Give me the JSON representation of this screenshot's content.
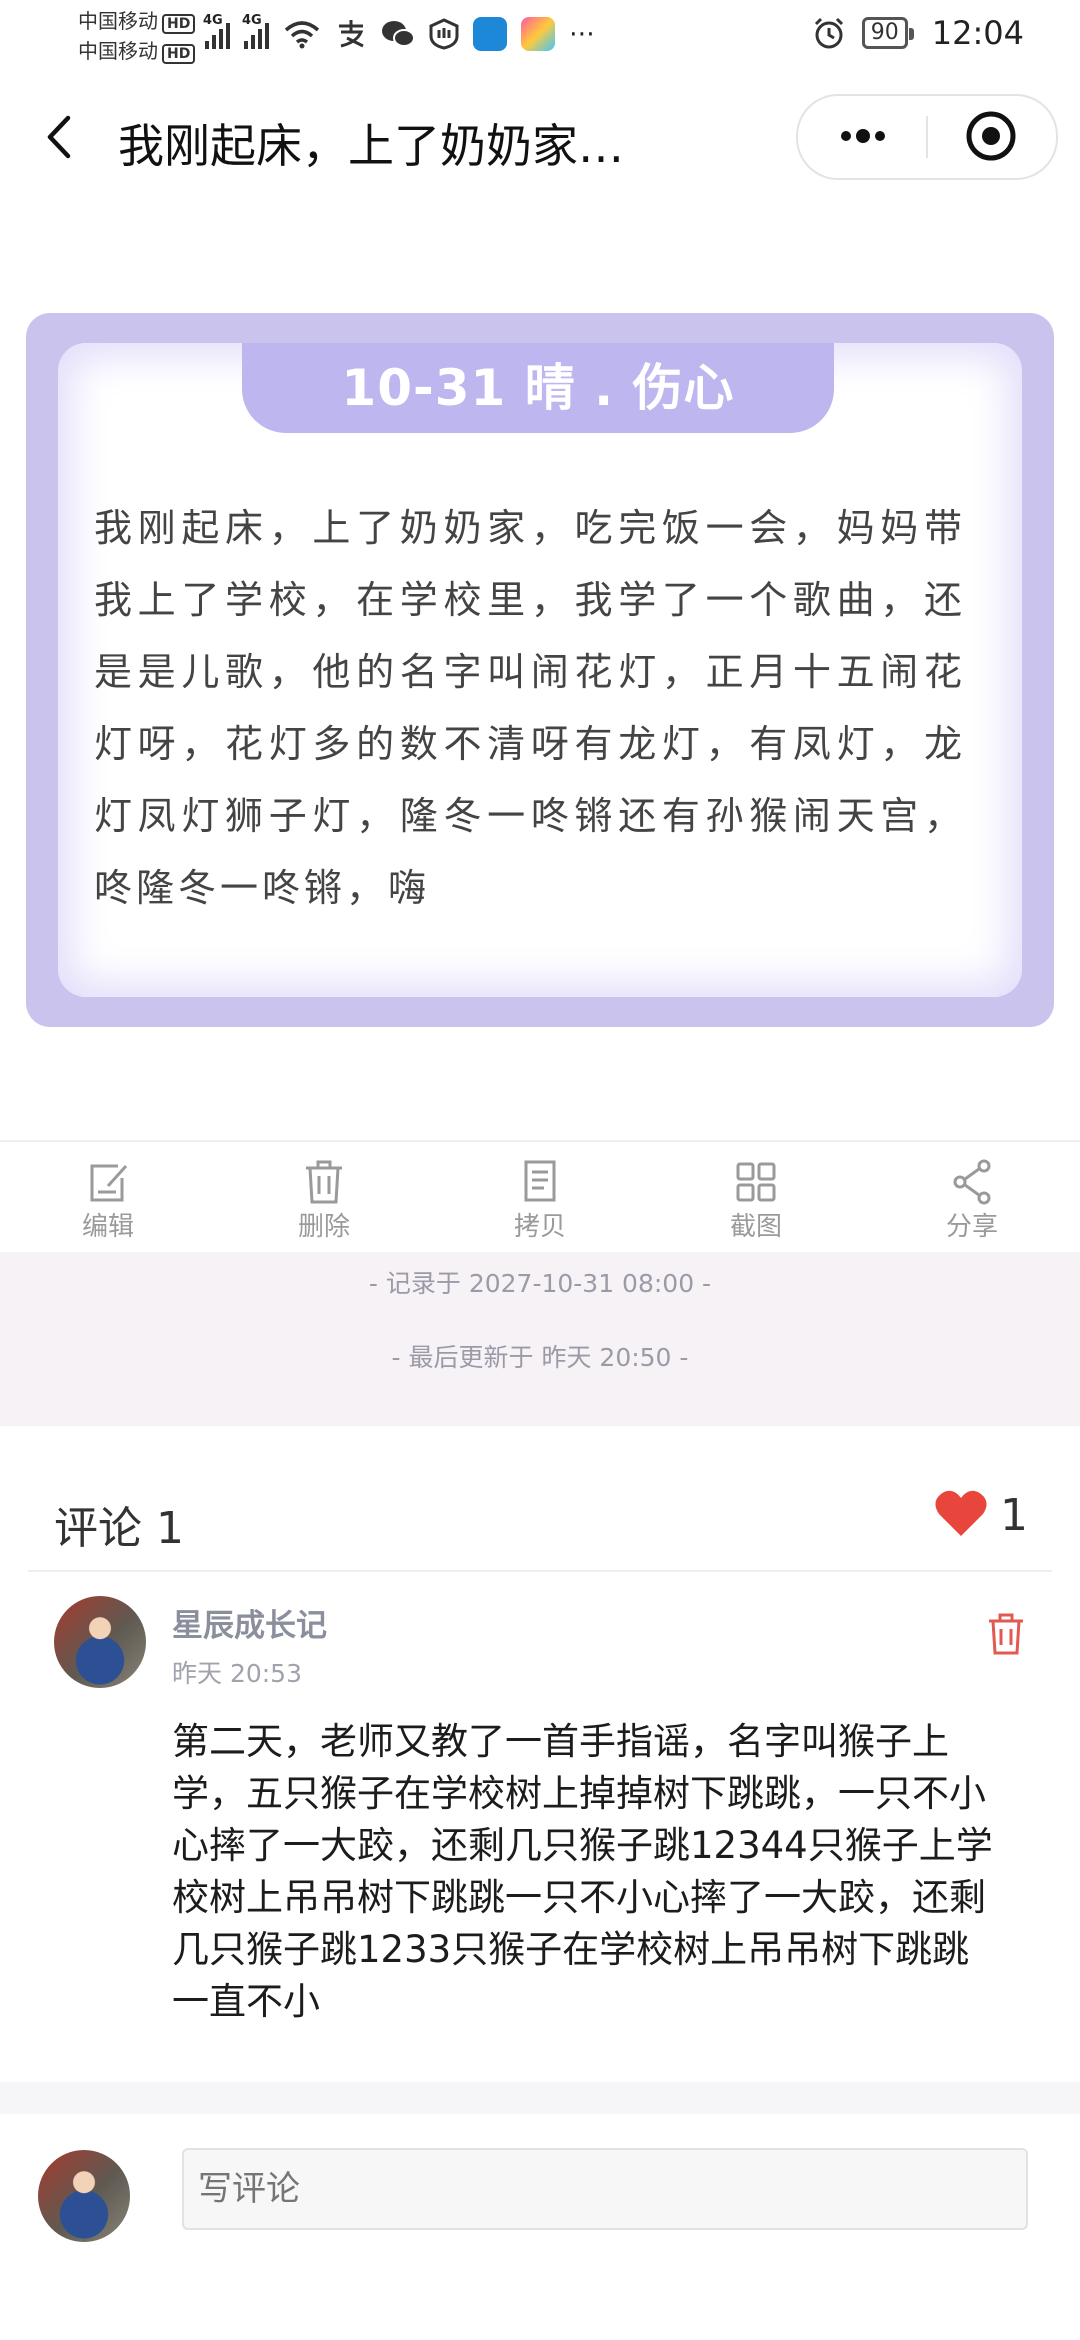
{
  "status_bar": {
    "carrier1": "中国移动",
    "carrier2": "中国移动",
    "hd": "HD",
    "network": "4G",
    "battery": "90",
    "time": "12:04"
  },
  "nav": {
    "title": "我刚起床，上了奶奶家…"
  },
  "diary": {
    "heading": "10-31 晴 . 伤心",
    "body": "我刚起床，上了奶奶家，吃完饭一会，妈妈带我上了学校，在学校里，我学了一个歌曲，还是是儿歌，他的名字叫闹花灯，正月十五闹花灯呀，花灯多的数不清呀有龙灯，有凤灯，龙灯凤灯狮子灯，隆冬一咚锵还有孙猴闹天宫，咚隆冬一咚锵，嗨"
  },
  "toolbar": {
    "edit": "编辑",
    "delete": "删除",
    "copy": "拷贝",
    "screenshot": "截图",
    "share": "分享"
  },
  "meta": {
    "recorded": "- 记录于 2027-10-31 08:00 -",
    "updated": "- 最后更新于 昨天 20:50 -"
  },
  "comments": {
    "title": "评论 1",
    "likes": "1",
    "items": [
      {
        "author": "星辰成长记",
        "time": "昨天 20:53",
        "text": "第二天，老师又教了一首手指谣，名字叫猴子上学，五只猴子在学校树上掉掉树下跳跳，一只不小心摔了一大跤，还剩几只猴子跳12344只猴子上学校树上吊吊树下跳跳一只不小心摔了一大跤，还剩几只猴子跳1233只猴子在学校树上吊吊树下跳跳一直不小"
      }
    ]
  },
  "composer": {
    "placeholder": "写评论"
  },
  "colors": {
    "card_border": "#c9c3ee",
    "tab": "#bdb6ef",
    "heart": "#e8453c",
    "meta_bg": "#f7f2f6"
  }
}
